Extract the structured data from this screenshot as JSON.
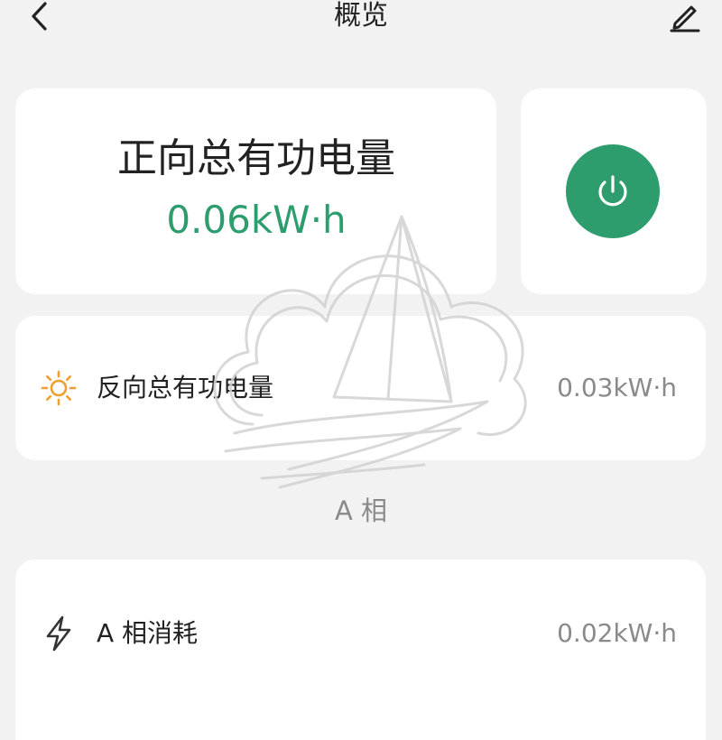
{
  "header": {
    "title": "概览",
    "back_icon": "chevron-left-icon",
    "edit_icon": "pencil-icon"
  },
  "energy": {
    "label": "正向总有功电量",
    "value": "0.06kW·h",
    "accent": "#2e9d6e"
  },
  "power": {
    "icon": "power-icon",
    "color": "#2e9d6e"
  },
  "reverse": {
    "icon": "sun-icon",
    "icon_color": "#f0a030",
    "label": "反向总有功电量",
    "value": "0.03kW·h"
  },
  "phase_a": {
    "section_label": "A 相",
    "consumption_icon": "lightning-icon",
    "consumption_label": "A 相消耗",
    "consumption_value": "0.02kW·h"
  },
  "watermark": {
    "icon": "sailboat-cloud-watermark"
  }
}
